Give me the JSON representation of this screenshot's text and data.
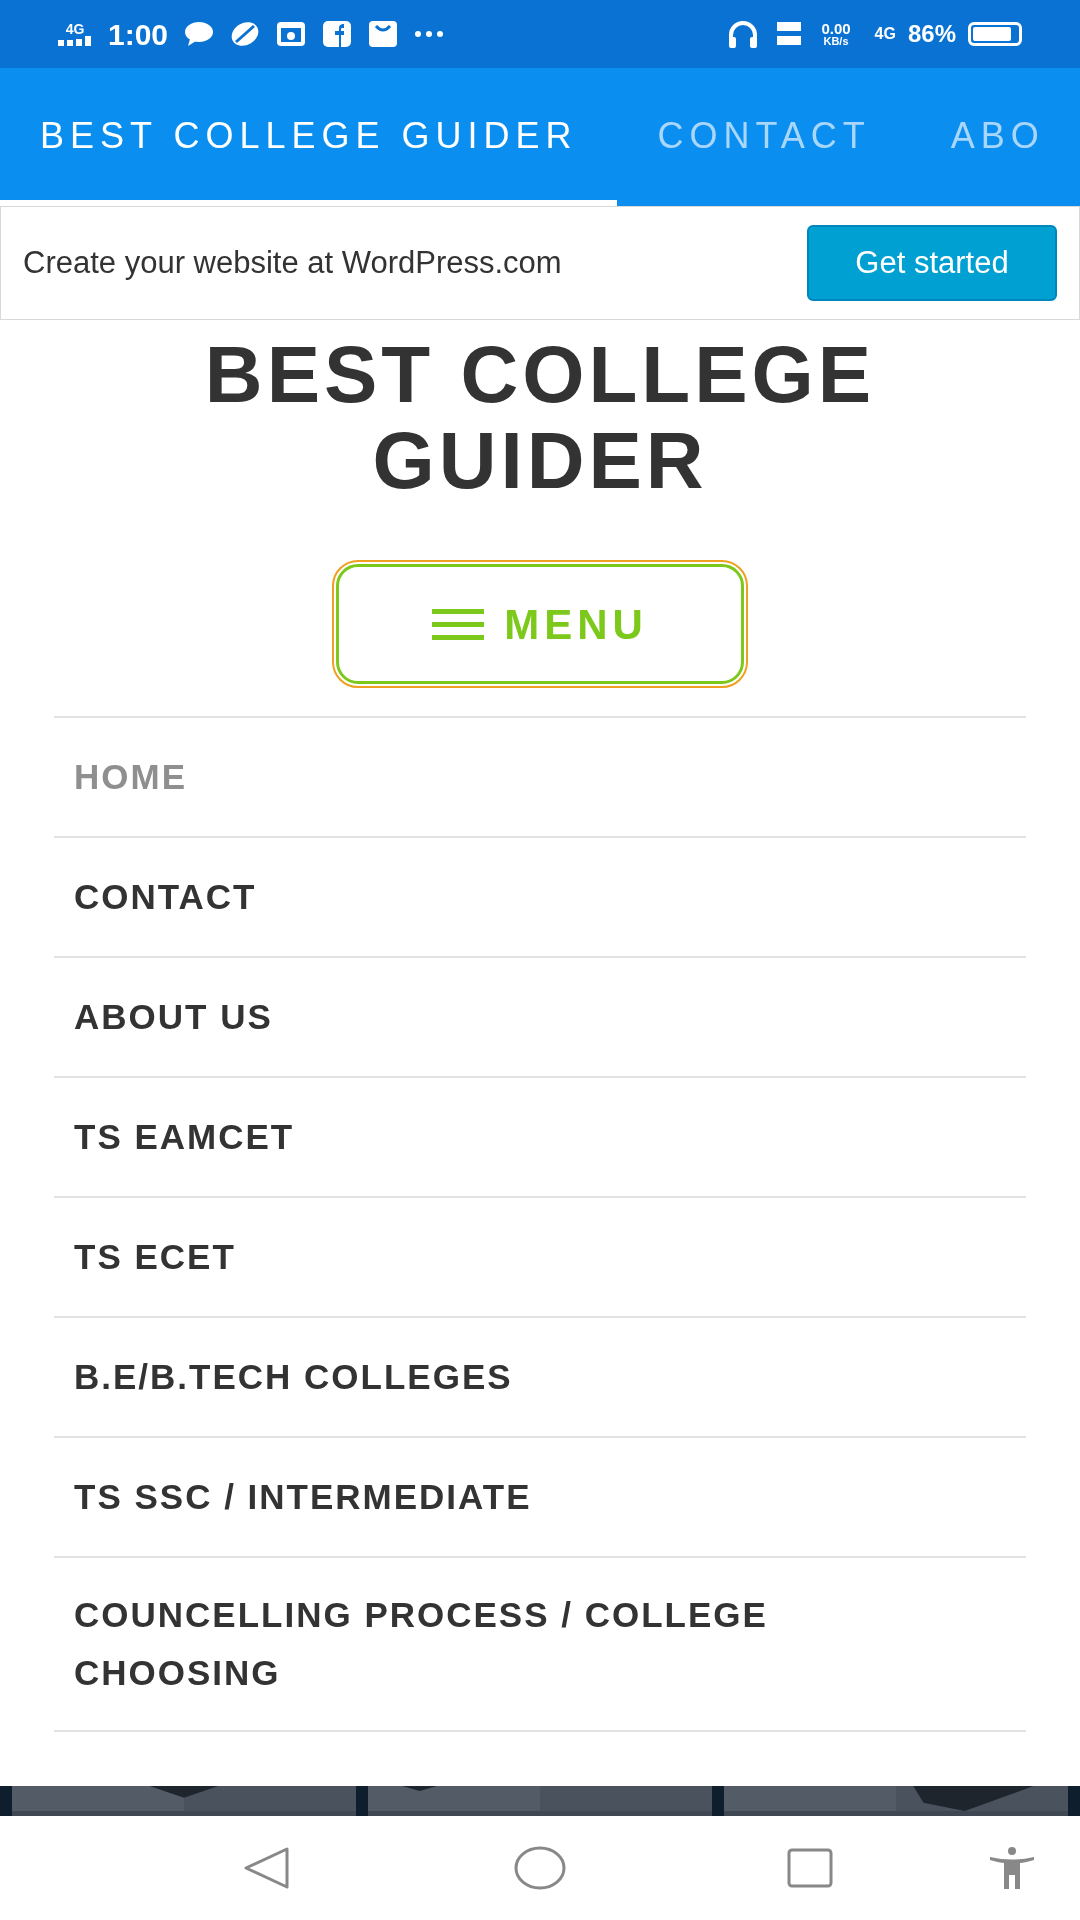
{
  "status_bar": {
    "network": "4G",
    "time": "1:00",
    "speed_value": "0.00",
    "speed_unit": "KB/s",
    "data_network": "4G",
    "battery": {
      "text": "86%",
      "level": 0.86
    }
  },
  "tabs": [
    {
      "label": "BEST COLLEGE GUIDER",
      "selected": true
    },
    {
      "label": "CONTACT",
      "selected": false
    },
    {
      "label": "ABO",
      "selected": false
    }
  ],
  "banner": {
    "text": "Create your website at WordPress.com",
    "button": "Get started"
  },
  "site_title": "BEST COLLEGE GUIDER",
  "menu_button": {
    "label": "MENU",
    "focused": true
  },
  "menu": [
    {
      "label": "HOME",
      "current": true
    },
    {
      "label": "CONTACT",
      "current": false
    },
    {
      "label": "ABOUT US",
      "current": false
    },
    {
      "label": "TS EAMCET",
      "current": false
    },
    {
      "label": "TS ECET",
      "current": false
    },
    {
      "label": "B.E/B.TECH COLLEGES",
      "current": false
    },
    {
      "label": "TS SSC / INTERMEDIATE",
      "current": false
    },
    {
      "label": "COUNCELLING PROCESS / COLLEGE CHOOSING",
      "current": false
    }
  ]
}
